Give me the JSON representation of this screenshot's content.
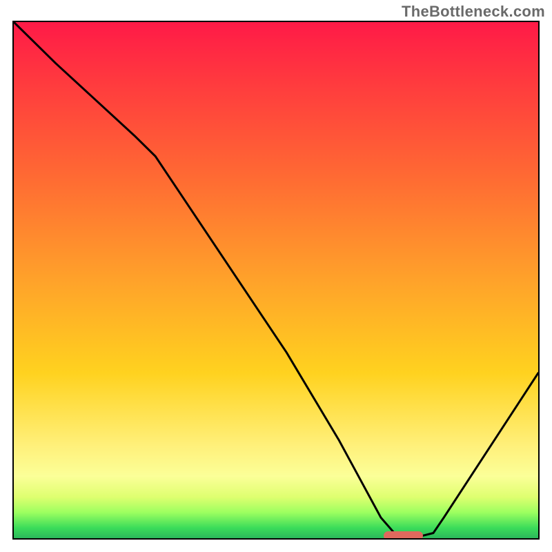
{
  "watermark": "TheBottleneck.com",
  "chart_data": {
    "type": "line",
    "title": "",
    "xlabel": "",
    "ylabel": "",
    "xlim": [
      0,
      100
    ],
    "ylim": [
      0,
      100
    ],
    "grid": false,
    "series": [
      {
        "name": "curve",
        "x": [
          0,
          8,
          23,
          27,
          52,
          62,
          70,
          73,
          78,
          80,
          82,
          100
        ],
        "y": [
          100,
          92,
          78,
          74,
          36,
          19,
          4,
          0.5,
          0.5,
          1,
          4,
          32
        ]
      }
    ],
    "marker": {
      "x_start": 70.5,
      "x_end": 78,
      "y": 0.5
    },
    "background_gradient": "red-to-green vertical"
  }
}
